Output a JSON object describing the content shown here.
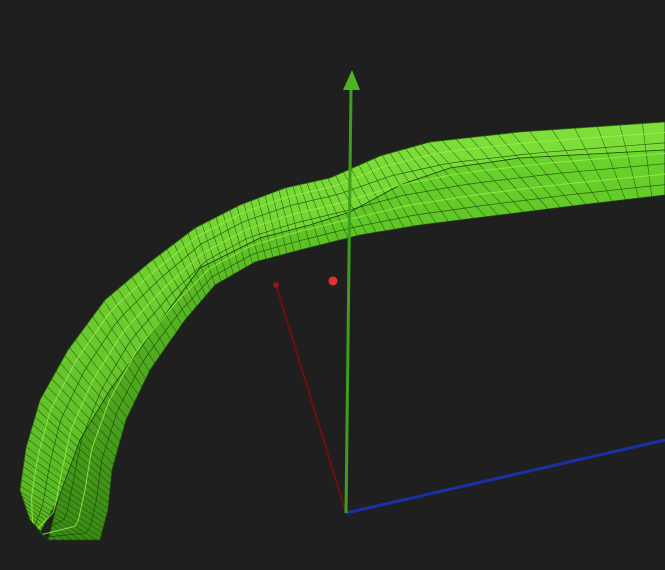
{
  "viewport": {
    "background_color": "#1f1f1f",
    "mesh_color": "#6edb2c",
    "mesh_highlight_color": "#9bf04a",
    "mesh_shadow_color": "#2f6e12",
    "mesh_line_color": "#173a07",
    "axes": [
      {
        "name": "y-axis",
        "color": "#3f9e1c",
        "has_arrowhead": true
      },
      {
        "name": "x-axis",
        "color": "#1a2fa8",
        "has_arrowhead": false
      },
      {
        "name": "z-axis",
        "color": "#6e0f0a",
        "has_arrowhead": false
      }
    ],
    "markers": [
      {
        "name": "pivot-point",
        "color": "#e2332b"
      },
      {
        "name": "z-axis-endpoint",
        "color": "#8a1a12"
      }
    ]
  }
}
